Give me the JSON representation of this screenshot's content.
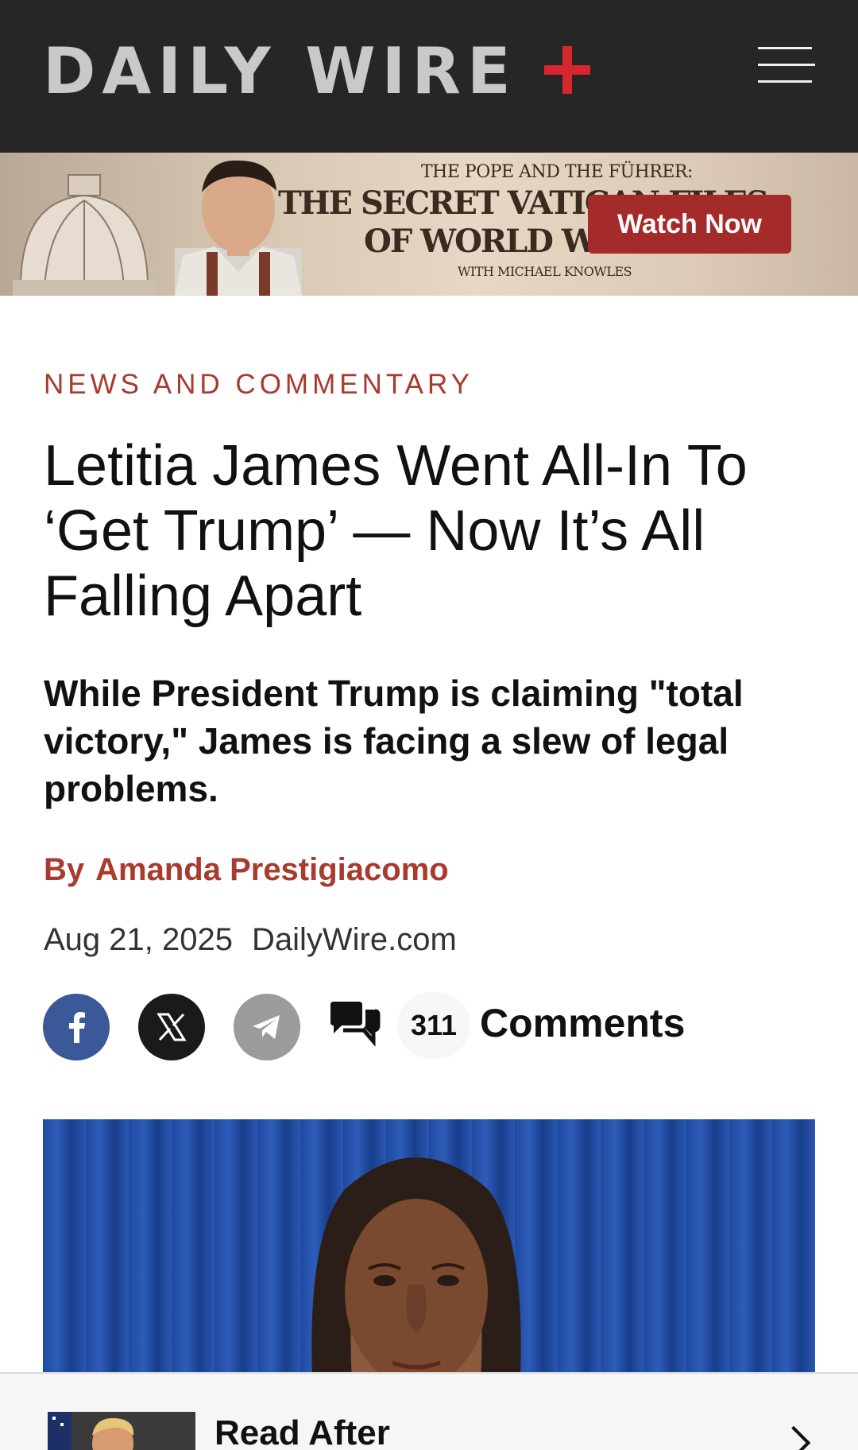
{
  "header": {
    "logo_text": "DAILY WIRE",
    "logo_plus_color": "#d8262e",
    "menu_icon": "hamburger-menu-icon"
  },
  "ad": {
    "kicker": "THE POPE AND THE FÜHRER:",
    "title_line1": "THE SECRET VATICAN FILES",
    "title_line2": "OF WORLD WAR II",
    "credit": "WITH MICHAEL KNOWLES",
    "cta": "Watch Now",
    "cta_color": "#a52a2a"
  },
  "article": {
    "section": "NEWS AND COMMENTARY",
    "headline": "Letitia James Went All-In To ‘Get Trump’ — Now It’s All Falling Apart",
    "dek": "While President Trump is claiming \"total victory,\" James is facing a slew of legal problems.",
    "byline_prefix": "By",
    "author": "Amanda Prestigiacomo",
    "date": "Aug 21, 2025",
    "source": "DailyWire.com",
    "accent_color": "#a83a2e"
  },
  "share": {
    "facebook_icon": "facebook-icon",
    "x_icon": "x-icon",
    "telegram_icon": "telegram-icon",
    "comment_icon": "comments-icon",
    "comment_count": "311",
    "comment_label": "Comments"
  },
  "read_after": {
    "label": "Read After"
  }
}
